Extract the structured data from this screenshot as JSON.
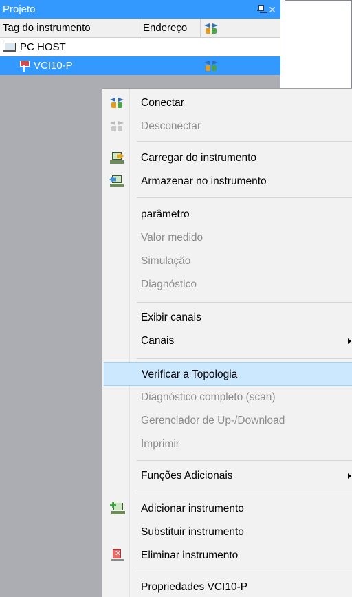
{
  "panel": {
    "title": "Projeto",
    "columns": {
      "tag": "Tag do instrumento",
      "address": "Endereço",
      "connection_icon": "connect-icon"
    },
    "rows": [
      {
        "name": "PC HOST",
        "icon": "pc-host-icon",
        "selected": false
      },
      {
        "name": "VCI10-P",
        "icon": "device-icon",
        "selected": true,
        "connection_icon": "connect-icon"
      }
    ]
  },
  "colors": {
    "accent": "#3399ff",
    "highlight": "#cce8ff",
    "menu_background": "#f2f2f2",
    "panel_background": "#abadb3",
    "disabled_text": "#8d8d8d"
  },
  "context_menu": {
    "items": [
      {
        "label": "Conectar",
        "icon": "connect-icon",
        "enabled": true
      },
      {
        "label": "Desconectar",
        "icon": "disconnect-icon",
        "enabled": false
      },
      {
        "label": "Carregar do instrumento",
        "icon": "load-from-device-icon",
        "enabled": true
      },
      {
        "label": "Armazenar no instrumento",
        "icon": "store-to-device-icon",
        "enabled": true
      },
      {
        "label": "parâmetro",
        "enabled": true
      },
      {
        "label": "Valor medido",
        "enabled": false
      },
      {
        "label": "Simulação",
        "enabled": false
      },
      {
        "label": "Diagnóstico",
        "enabled": false
      },
      {
        "label": "Exibir canais",
        "enabled": true
      },
      {
        "label": "Canais",
        "enabled": true,
        "submenu": true
      },
      {
        "label": "Verificar a Topologia",
        "enabled": true,
        "highlighted": true
      },
      {
        "label": "Diagnóstico completo (scan)",
        "enabled": false
      },
      {
        "label": "Gerenciador de Up-/Download",
        "enabled": false
      },
      {
        "label": "Imprimir",
        "enabled": false
      },
      {
        "label": "Funções Adicionais",
        "enabled": true,
        "submenu": true
      },
      {
        "label": "Adicionar instrumento",
        "icon": "add-device-icon",
        "enabled": true
      },
      {
        "label": "Substituir instrumento",
        "enabled": true
      },
      {
        "label": "Eliminar instrumento",
        "icon": "delete-device-icon",
        "enabled": true
      },
      {
        "label": "Propriedades VCI10-P",
        "enabled": true
      }
    ]
  }
}
